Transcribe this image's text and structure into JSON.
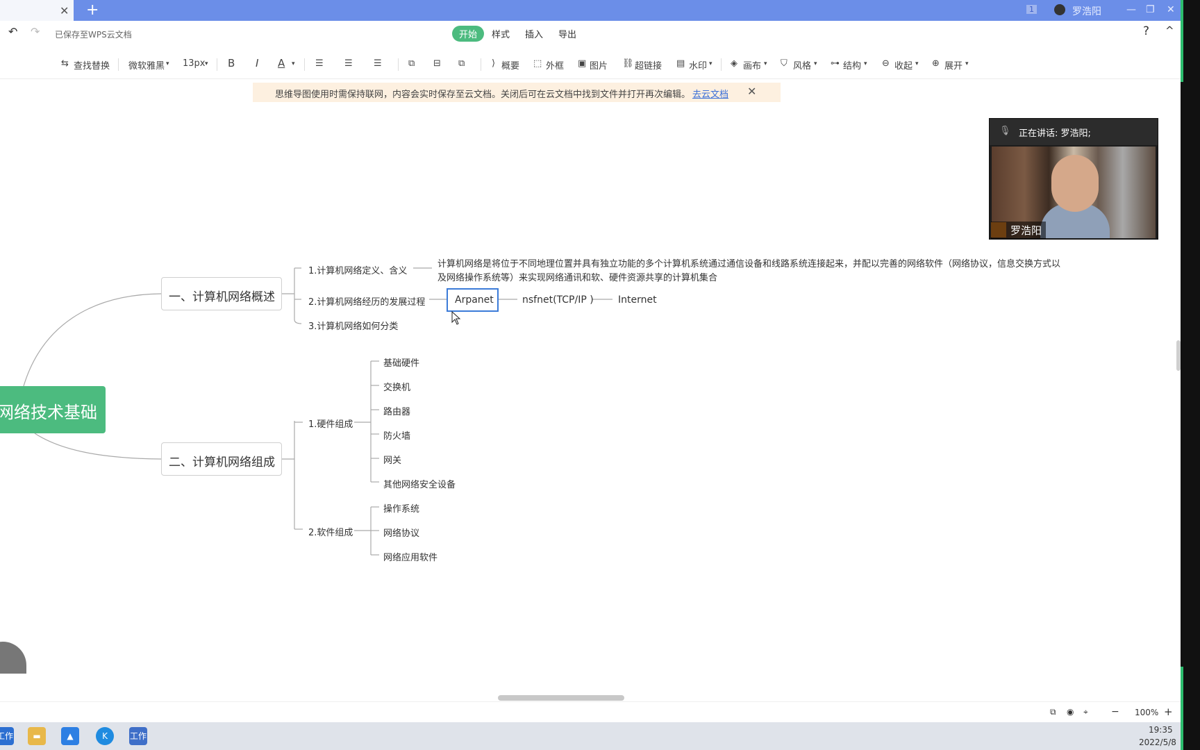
{
  "tabbar": {
    "close_glyph": "✕",
    "new_tab_glyph": "+",
    "user_name": "罗浩阳",
    "badge": "1"
  },
  "menubar": {
    "saved_status": "已保存至WPS云文档",
    "tabs": [
      "开始",
      "样式",
      "插入",
      "导出"
    ],
    "help": "?",
    "collapse": "^"
  },
  "toolbar": {
    "find_replace": "查找替换",
    "font": "微软雅黑",
    "size": "13px",
    "bold": "B",
    "italic": "I",
    "color": "A",
    "summary": "概要",
    "frame": "外框",
    "image": "图片",
    "hyperlink": "超链接",
    "watermark": "水印",
    "canvas": "画布",
    "style": "风格",
    "structure": "结构",
    "collapse": "收起",
    "expand": "展开"
  },
  "notice": {
    "message": "思维导图使用时需保持联网，内容会实时保存至云文档。关闭后可在云文档中找到文件并打开再次编辑。",
    "link": "去云文档",
    "close": "✕"
  },
  "video": {
    "speaking": "正在讲话: 罗浩阳;",
    "name": "罗浩阳"
  },
  "mindmap": {
    "root": "网络技术基础",
    "branch1": {
      "label": "一、计算机网络概述",
      "children": [
        "1.计算机网络定义、含义",
        "2.计算机网络经历的发展过程",
        "3.计算机网络如何分类"
      ],
      "definition_line1": "计算机网络是将位于不同地理位置并具有独立功能的多个计算机系统通过通信设备和线路系统连接起来，并配以完善的网络软件（网络协议，信息交换方式以",
      "definition_line2": "及网络操作系统等）来实现网络通讯和软、硬件资源共享的计算机集合",
      "history": [
        "Arpanet",
        "nsfnet(TCP/IP )",
        "Internet"
      ]
    },
    "branch2": {
      "label": "二、计算机网络组成",
      "hardware": {
        "label": "1.硬件组成",
        "items": [
          "基础硬件",
          "交换机",
          "路由器",
          "防火墙",
          "网关",
          "其他网络安全设备"
        ]
      },
      "software": {
        "label": "2.软件组成",
        "items": [
          "操作系统",
          "网络协议",
          "网络应用软件"
        ]
      }
    }
  },
  "statusbar": {
    "zoom": "100%",
    "minus": "−",
    "plus": "+"
  },
  "taskbar": {
    "time": "19:35",
    "date": "2022/5/8",
    "app1": "工作",
    "app5": "工作"
  }
}
